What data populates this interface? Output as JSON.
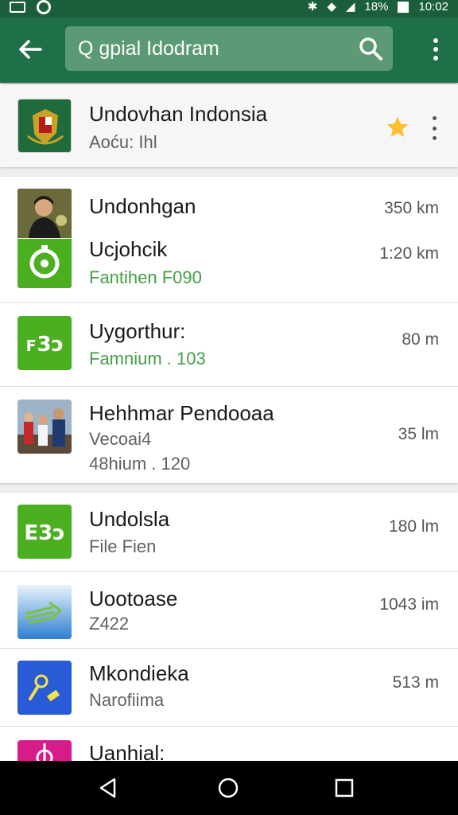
{
  "status_bar": {
    "battery": "18%",
    "time": "10:02"
  },
  "search": {
    "query": "Q gpial Idodram"
  },
  "featured": {
    "title": "Undovhan Indonsia",
    "subtitle": "Aoću: Ihl",
    "starred": true
  },
  "group1": [
    {
      "title": "Undonhgan",
      "subtitle": "",
      "distance": "350 km",
      "icon": "portrait-photo-icon"
    },
    {
      "title": "Ucjohcik",
      "subtitle": "Fantihen F090",
      "subtitle_color": "green",
      "distance": "1:20 km",
      "icon": "green-app-icon"
    },
    {
      "title": "Uygorthur:",
      "subtitle": "Famnium . 103",
      "subtitle_color": "green",
      "distance": "80 m",
      "icon": "green-app-icon"
    },
    {
      "title": "Hehhmar Pendooaa",
      "subtitle": "Vecoai4",
      "subtitle2": "48hium . 120",
      "distance": "35 lm",
      "icon": "group-photo-icon"
    }
  ],
  "group2": [
    {
      "title": "Undolsla",
      "subtitle": "File Fien",
      "distance": "180 lm",
      "icon": "green-app-icon"
    },
    {
      "title": "Uootoase",
      "subtitle": "Z422",
      "distance": "1043 im",
      "icon": "blue-arrow-icon"
    },
    {
      "title": "Mkondieka",
      "subtitle": "Narofiima",
      "distance": "513 m",
      "icon": "blue-key-icon"
    },
    {
      "title": "Uanhial:",
      "subtitle": "",
      "distance": "",
      "icon": "magenta-app-icon"
    }
  ],
  "colors": {
    "status_bar": "#1b5e3c",
    "app_bar": "#1e7048",
    "search_box": "#5b9a74",
    "accent_green": "#43a047",
    "star": "#fbc02d"
  }
}
